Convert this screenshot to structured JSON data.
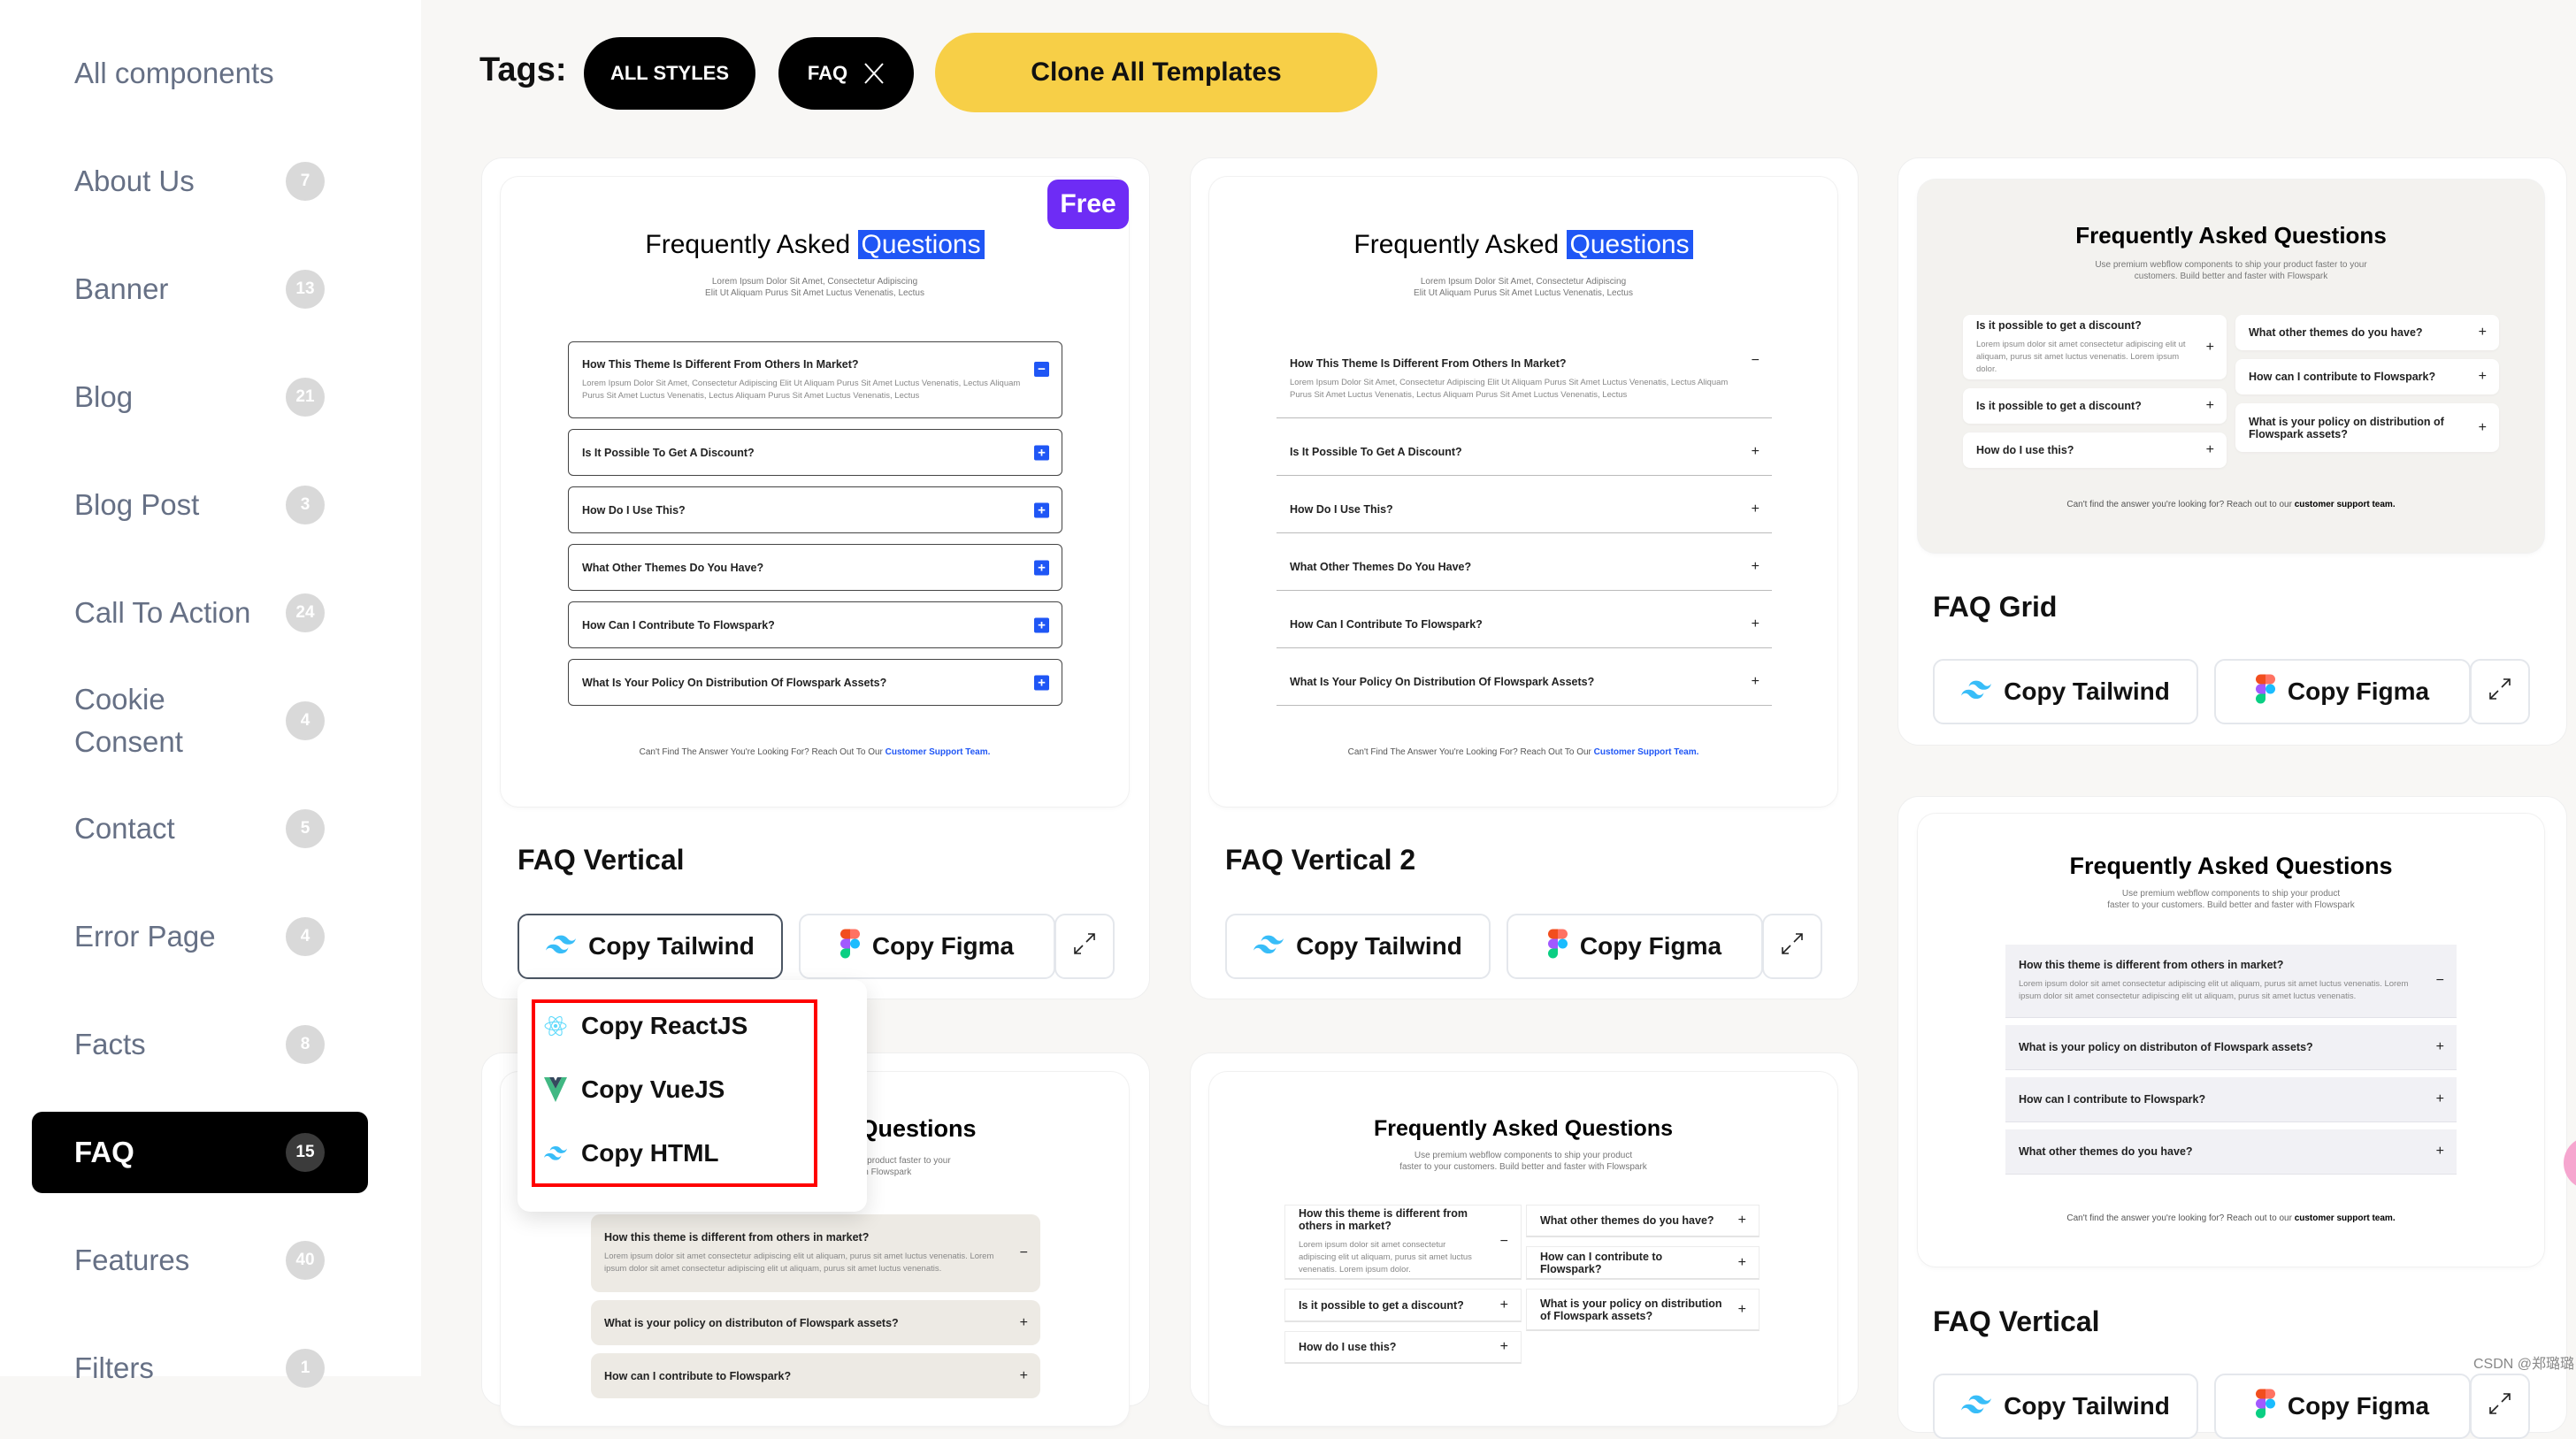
{
  "sidebar": {
    "items": [
      {
        "label": "All components"
      },
      {
        "label": "About Us",
        "count": "7"
      },
      {
        "label": "Banner",
        "count": "13"
      },
      {
        "label": "Blog",
        "count": "21"
      },
      {
        "label": "Blog Post",
        "count": "3"
      },
      {
        "label": "Call To Action",
        "count": "24"
      },
      {
        "label": "Cookie Consent",
        "count": "4"
      },
      {
        "label": "Contact",
        "count": "5"
      },
      {
        "label": "Error Page",
        "count": "4"
      },
      {
        "label": "Facts",
        "count": "8"
      },
      {
        "label": "FAQ",
        "count": "15",
        "active": true
      },
      {
        "label": "Features",
        "count": "40"
      },
      {
        "label": "Filters",
        "count": "1"
      }
    ]
  },
  "tags": {
    "label": "Tags:",
    "all_styles": "ALL STYLES",
    "faq": "FAQ",
    "clone": "Clone All Templates"
  },
  "buttons": {
    "tailwind": "Copy Tailwind",
    "figma": "Copy Figma"
  },
  "dropdown": {
    "items": [
      "Copy ReactJS",
      "Copy VueJS",
      "Copy HTML"
    ]
  },
  "colors": {
    "accent_yellow": "#f7cf47",
    "free_badge": "#6e2cf5",
    "highlight_blue": "#1f56f5",
    "dropdown_outline": "#ff0000"
  },
  "cards": [
    {
      "title": "FAQ Vertical",
      "badge": "Free",
      "preview": {
        "heading": "Frequently Asked",
        "heading_highlight": "Questions",
        "subtitle": [
          "Lorem Ipsum Dolor Sit Amet, Consectetur Adipiscing",
          "Elit Ut Aliquam Purus Sit Amet Luctus Venenatis, Lectus"
        ],
        "items": [
          {
            "q": "How This Theme Is Different From Others In Market?",
            "a": "Lorem Ipsum Dolor Sit Amet, Consectetur Adipiscing Elit Ut Aliquam Purus Sit Amet Luctus Venenatis, Lectus Aliquam Purus Sit Amet Luctus Venenatis, Lectus  Aliquam Purus Sit Amet Luctus Venenatis, Lectus",
            "icon": "minus"
          },
          {
            "q": "Is It Possible To Get A Discount?",
            "icon": "plus"
          },
          {
            "q": "How Do I Use This?",
            "icon": "plus"
          },
          {
            "q": "What Other Themes Do You Have?",
            "icon": "plus"
          },
          {
            "q": "How Can I Contribute To Flowspark?",
            "icon": "plus"
          },
          {
            "q": "What Is Your Policy On Distribution Of Flowspark Assets?",
            "icon": "plus"
          }
        ],
        "footer": "Can't Find The Answer You're Looking For? Reach Out To Our ",
        "footer_link": "Customer Support Team."
      }
    },
    {
      "title": "FAQ Vertical 2",
      "preview": {
        "heading": "Frequently Asked",
        "heading_highlight": "Questions",
        "subtitle": [
          "Lorem Ipsum Dolor Sit Amet, Consectetur Adipiscing",
          "Elit Ut Aliquam Purus Sit Amet Luctus Venenatis, Lectus"
        ],
        "items": [
          {
            "q": "How This Theme Is Different From Others In Market?",
            "a": "Lorem Ipsum Dolor Sit Amet, Consectetur Adipiscing Elit Ut Aliquam Purus Sit Amet Luctus Venenatis, Lectus Aliquam Purus Sit Amet Luctus Venenatis, Lectus  Aliquam Purus Sit Amet Luctus Venenatis, Lectus",
            "icon": "minus"
          },
          {
            "q": "Is It Possible To Get A Discount?",
            "icon": "plus"
          },
          {
            "q": "How Do I Use This?",
            "icon": "plus"
          },
          {
            "q": "What Other Themes Do You Have?",
            "icon": "plus"
          },
          {
            "q": "How Can I Contribute To Flowspark?",
            "icon": "plus"
          },
          {
            "q": "What Is Your Policy On Distribution Of Flowspark Assets?",
            "icon": "plus"
          }
        ],
        "footer": "Can't Find The Answer You're Looking For? Reach Out To Our ",
        "footer_link": "Customer Support Team."
      }
    },
    {
      "title": "FAQ Grid",
      "preview": {
        "heading": "Frequently Asked Questions",
        "subtitle": [
          "Use premium webflow components to ship your product faster to your",
          "customers. Build better and faster with Flowspark"
        ],
        "left": [
          {
            "q": "Is it possible to get a discount?",
            "a": "Lorem ipsum dolor sit amet consectetur adipiscing elit ut aliquam, purus sit amet luctus venenatis. Lorem ipsum dolor.",
            "icon": "plus"
          },
          {
            "q": "Is it possible to get a discount?",
            "icon": "plus"
          },
          {
            "q": "How do I use this?",
            "icon": "plus"
          }
        ],
        "right": [
          {
            "q": "What other themes do you have?",
            "icon": "plus"
          },
          {
            "q": "How can I contribute to Flowspark?",
            "icon": "plus"
          },
          {
            "q": "What is your policy on distribution of Flowspark assets?",
            "icon": "plus"
          }
        ],
        "footer": "Can't find the answer you're looking for? Reach out to our ",
        "footer_link": "customer support team."
      }
    },
    {
      "title": "FAQ Vertical",
      "preview": {
        "heading": "Frequently Asked Questions",
        "subtitle": [
          "Use premium webflow components to ship your product",
          "faster  to your customers. Build better and faster with Flowspark"
        ],
        "items": [
          {
            "q": "How this theme is different from others in market?",
            "a": "Lorem ipsum dolor sit amet consectetur adipiscing elit ut aliquam, purus sit amet luctus venenatis. Lorem ipsum dolor sit amet consectetur adipiscing elit ut aliquam, purus sit amet luctus venenatis.",
            "icon": "minus"
          },
          {
            "q": "What is your policy on distributon of Flowspark assets?",
            "icon": "plus"
          },
          {
            "q": "How can I contribute to Flowspark?",
            "icon": "plus"
          },
          {
            "q": "What other themes do you have?",
            "icon": "plus"
          }
        ],
        "footer": "Can't find the answer you're looking for? Reach out to our ",
        "footer_link": "customer support team."
      }
    },
    {
      "preview": {
        "heading": "Frequently Asked Questions",
        "subtitle": [
          "Use premium webflow components to ship your product faster to your",
          "customers. Build better and faster with Flowspark"
        ],
        "items": [
          {
            "q": "How this theme is different from others in market?",
            "a": "Lorem ipsum dolor sit amet consectetur adipiscing elit ut aliquam, purus sit amet luctus venenatis. Lorem ipsum dolor sit amet consectetur adipiscing elit ut aliquam, purus sit amet luctus venenatis.",
            "icon": "minus"
          },
          {
            "q": "What is your policy on distributon of Flowspark assets?",
            "icon": "plus"
          },
          {
            "q": "How can I contribute to Flowspark?",
            "icon": "plus"
          }
        ]
      }
    },
    {
      "preview": {
        "heading": "Frequently Asked Questions",
        "subtitle": [
          "Use premium webflow components to ship your product",
          "faster  to your customers. Build better and faster with Flowspark"
        ],
        "left": [
          {
            "q": "How this theme is different from others in market?",
            "a": "Lorem ipsum dolor sit amet consectetur adipiscing elit ut aliquam, purus sit amet luctus venenatis. Lorem ipsum dolor.",
            "icon": "minus"
          },
          {
            "q": "Is it possible to get a discount?",
            "icon": "plus"
          },
          {
            "q": "How do I use this?",
            "icon": "plus"
          }
        ],
        "right": [
          {
            "q": "What other themes do you have?",
            "icon": "plus"
          },
          {
            "q": "How can I contribute to Flowspark?",
            "icon": "plus"
          },
          {
            "q": "What is your policy on distribution of Flowspark assets?",
            "icon": "plus"
          }
        ]
      }
    }
  ],
  "watermark": "CSDN @郑璐璐"
}
